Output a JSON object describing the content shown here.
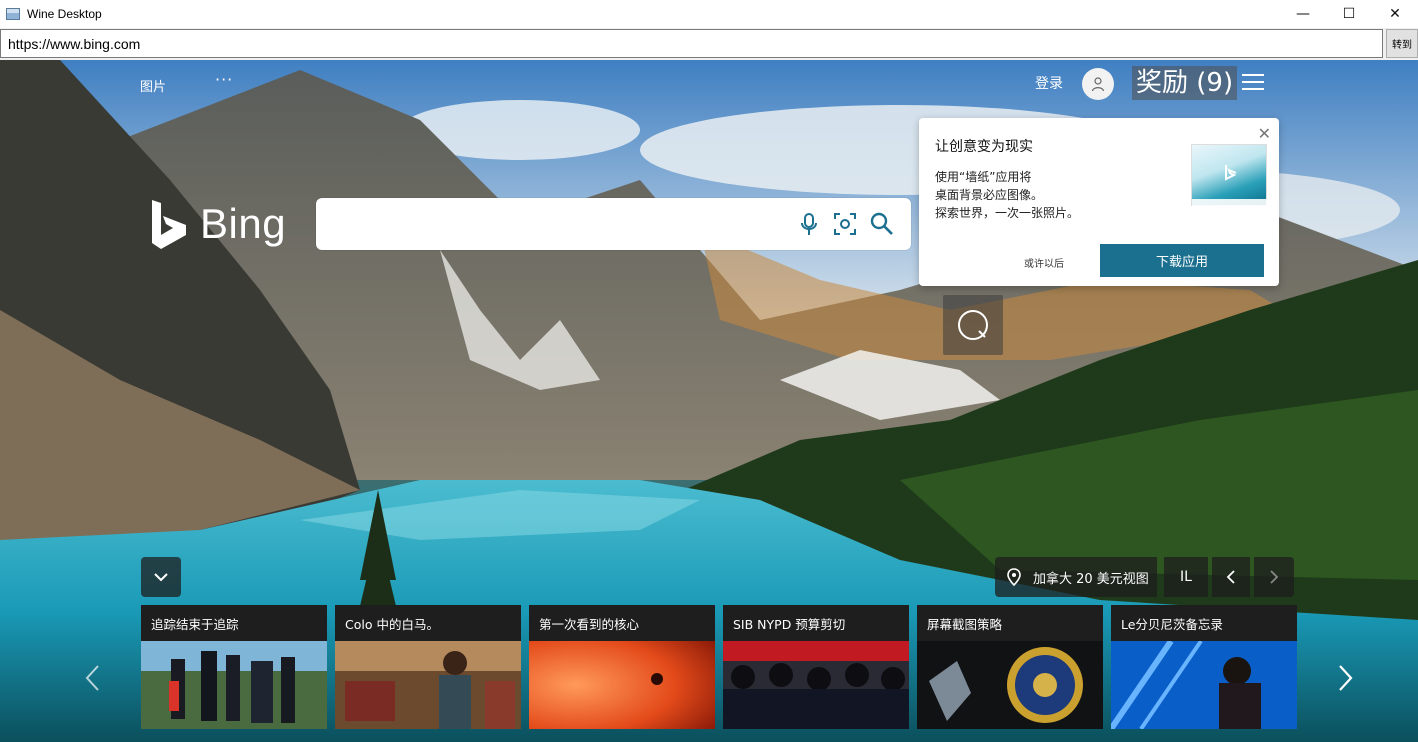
{
  "window": {
    "title": "Wine Desktop",
    "minimize": "—",
    "maximize": "☐",
    "close": "✕"
  },
  "address": {
    "url": "https://www.bing.com",
    "go_label": "转到"
  },
  "header": {
    "images_label": "图片",
    "more_label": "···",
    "signin_label": "登录",
    "rewards_label": "奖励 (9)"
  },
  "logo": {
    "text": "Bing"
  },
  "search": {
    "placeholder": "",
    "value": ""
  },
  "promo": {
    "title": "让创意变为现实",
    "body_line1": "使用“墙纸”应用将",
    "body_line2": "桌面背景必应图像。",
    "body_line3": "探索世界，一次一张照片。",
    "later_label": "或许以后",
    "download_label": "下载应用",
    "close_label": "✕"
  },
  "location": {
    "label": "加拿大 20 美元视图",
    "region": "IL"
  },
  "cards": [
    {
      "title": "追踪结束于追踪",
      "image": "rescue-officers"
    },
    {
      "title": "Colo 中的白马。",
      "image": "woman-in-restaurant"
    },
    {
      "title": "第一次看到的核心",
      "image": "red-planet-surface"
    },
    {
      "title": "SIB NYPD 预算剪切",
      "image": "nypd-officers"
    },
    {
      "title": "屏幕截图策略",
      "image": "police-badge"
    },
    {
      "title": "Le分贝尼茨备忘录",
      "image": "singer-on-stage"
    }
  ],
  "colors": {
    "accent": "#1b6f8f",
    "card_bg": "#1e1e1e",
    "lake": "#1fa5c0"
  }
}
